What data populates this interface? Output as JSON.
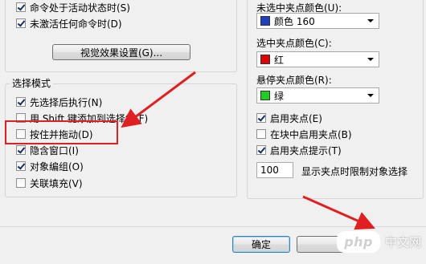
{
  "left_top": {
    "items": [
      {
        "label": "命令处于活动状态时(S)",
        "checked": true
      },
      {
        "label": "未激活任何命令时(D)",
        "checked": true
      }
    ],
    "visual_button": "视觉效果设置(G)..."
  },
  "selection_mode": {
    "title": "选择模式",
    "items": [
      {
        "label": "先选择后执行(N)",
        "checked": true
      },
      {
        "label": "用 Shift 键添加到选择集(F)",
        "checked": false
      },
      {
        "label": "按住并拖动(D)",
        "checked": false
      },
      {
        "label": "隐含窗口(I)",
        "checked": true
      },
      {
        "label": "对象编组(O)",
        "checked": true
      },
      {
        "label": "关联填充(V)",
        "checked": false
      }
    ]
  },
  "grips": {
    "unselected_label": "未选中夹点颜色(U):",
    "unselected_value": "颜色 160",
    "unselected_color": "#1f3fbf",
    "selected_label": "选中夹点颜色(C):",
    "selected_value": "红",
    "selected_color": "#e00000",
    "hover_label": "悬停夹点颜色(R):",
    "hover_value": "绿",
    "hover_color": "#22cc22",
    "checks": [
      {
        "label": "启用夹点(E)",
        "checked": true
      },
      {
        "label": "在块中启用夹点(B)",
        "checked": false
      },
      {
        "label": "启用夹点提示(T)",
        "checked": true
      }
    ],
    "limit_value": "100",
    "limit_label": "显示夹点时限制对象选择"
  },
  "footer": {
    "ok_label": "确定"
  },
  "watermark": {
    "logo": "php",
    "text": "中文网"
  },
  "colors": {
    "annotation_red": "#e02020"
  }
}
